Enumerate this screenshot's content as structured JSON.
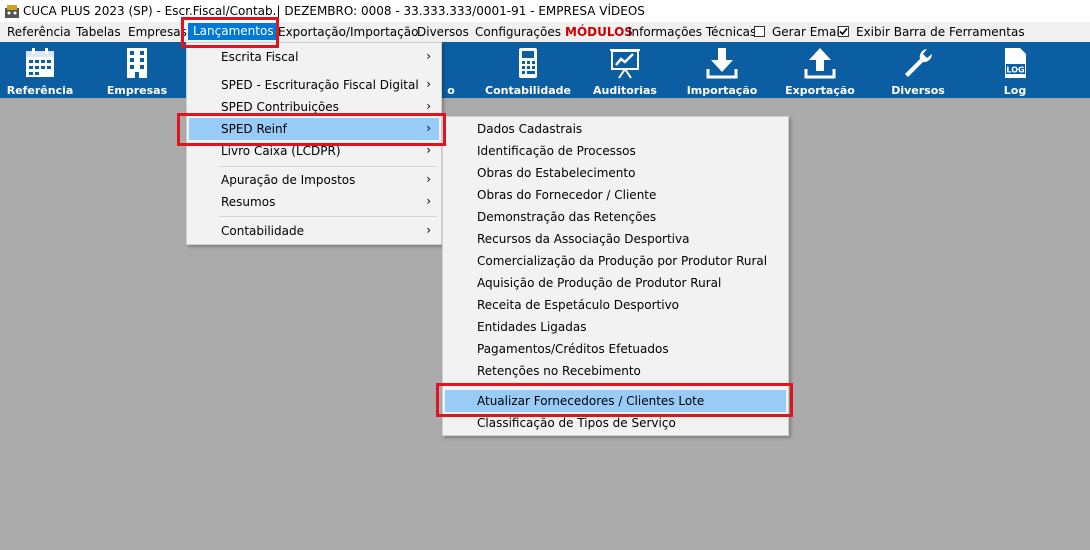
{
  "window": {
    "title": "CUCA PLUS 2023 (SP) - Escr.Fiscal/Contab.| DEZEMBRO: 0008 - 33.333.333/0001-91 - EMPRESA VÍDEOS"
  },
  "menubar": {
    "items": [
      "Referência",
      "Tabelas",
      "Empresas",
      "Lançamentos",
      "Exportação/Importação",
      "Diversos",
      "Configurações",
      "MÓDULOS",
      "Informações Técnicas"
    ],
    "gerar_email": {
      "label": "Gerar Email",
      "checked": false
    },
    "exibir_barra": {
      "label": "Exibir Barra de Ferramentas",
      "checked": true
    }
  },
  "toolbar": {
    "buttons": [
      {
        "label": "Referência",
        "icon": "calendar-icon"
      },
      {
        "label": "Empresas",
        "icon": "building-icon"
      },
      {
        "label": "o",
        "icon": "none"
      },
      {
        "label": "Contabilidade",
        "icon": "calculator-icon"
      },
      {
        "label": "Auditorias",
        "icon": "presentation-chart-icon"
      },
      {
        "label": "Importação",
        "icon": "download-arrow-icon"
      },
      {
        "label": "Exportação",
        "icon": "upload-arrow-icon"
      },
      {
        "label": "Diversos",
        "icon": "wrench-icon"
      },
      {
        "label": "Log",
        "icon": "log-file-icon"
      }
    ]
  },
  "lancamentos_menu": {
    "items": [
      "Escrita Fiscal",
      "SPED - Escrituração Fiscal Digital",
      "SPED Contribuições",
      "SPED Reinf",
      "Livro Caixa (LCDPR)",
      "Apuração de Impostos",
      "Resumos",
      "Contabilidade"
    ],
    "highlighted": "SPED Reinf"
  },
  "reinf_submenu": {
    "items": [
      "Dados Cadastrais",
      "Identificação de Processos",
      "Obras do Estabelecimento",
      "Obras do Fornecedor / Cliente",
      "Demonstração das Retenções",
      "Recursos da Associação Desportiva",
      "Comercialização da Produção por Produtor Rural",
      "Aquisição de Produção de Produtor Rural",
      "Receita de Espetáculo Desportivo",
      "Entidades Ligadas",
      "Pagamentos/Créditos Efetuados",
      "Retenções no Recebimento",
      "Atualizar Fornecedores / Clientes Lote",
      "Classificação de Tipos de Serviço"
    ],
    "highlighted": "Atualizar Fornecedores / Clientes Lote"
  },
  "colors": {
    "toolbar": "#0c5ea3",
    "menu_highlight": "#99cbf7",
    "annotation": "#e0141e",
    "modulos": "#d00000"
  }
}
